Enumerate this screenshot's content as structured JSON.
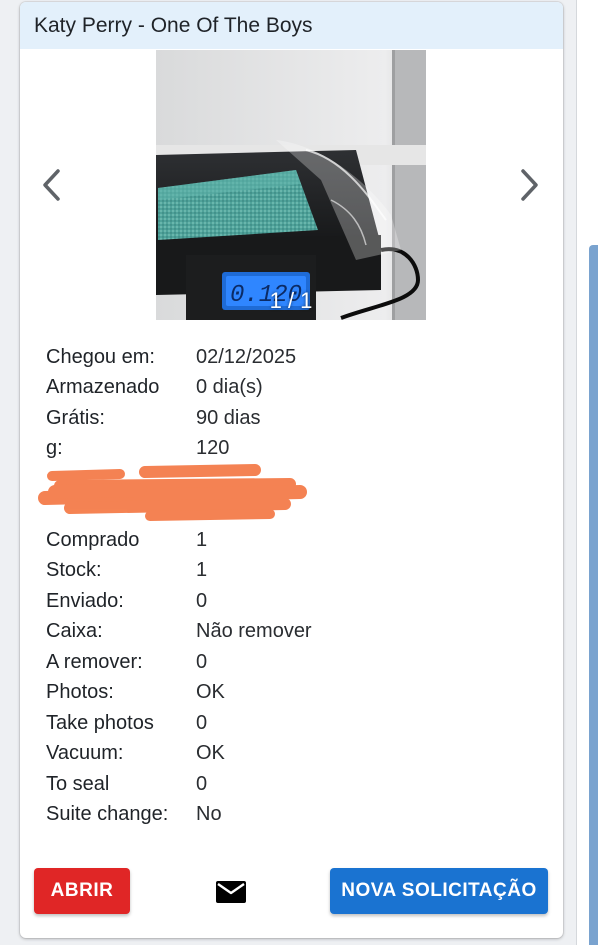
{
  "header": {
    "title": "Katy Perry - One Of The Boys"
  },
  "carousel": {
    "prev_icon": "chevron-left-icon",
    "next_icon": "chevron-right-icon",
    "counter": "1 / 1",
    "scale_display": "0.120"
  },
  "details": [
    {
      "label": "Chegou em:",
      "value": "02/12/2025"
    },
    {
      "label": "Armazenado",
      "value": "0 dia(s)"
    },
    {
      "label": "Grátis:",
      "value": "90 dias"
    },
    {
      "label": "g:",
      "value": "120"
    },
    {
      "label": "",
      "value": ""
    },
    {
      "label": "",
      "value": ""
    },
    {
      "label": "Comprado",
      "value": "1"
    },
    {
      "label": "Stock:",
      "value": "1"
    },
    {
      "label": "Enviado:",
      "value": "0"
    },
    {
      "label": "Caixa:",
      "value": "Não remover"
    },
    {
      "label": "A remover:",
      "value": "0"
    },
    {
      "label": "Photos:",
      "value": "OK"
    },
    {
      "label": "Take photos",
      "value": "0"
    },
    {
      "label": "Vacuum:",
      "value": "OK"
    },
    {
      "label": "To seal",
      "value": "0"
    },
    {
      "label": "Suite change:",
      "value": "No"
    }
  ],
  "actions": {
    "open_label": "ABRIR",
    "mail_icon": "envelope-icon",
    "new_request_label": "NOVA SOLICITAÇÃO"
  },
  "colors": {
    "header_bg": "#e3f0fb",
    "open_button": "#e02626",
    "new_button": "#1a73d1",
    "redaction": "#f47c4a"
  }
}
